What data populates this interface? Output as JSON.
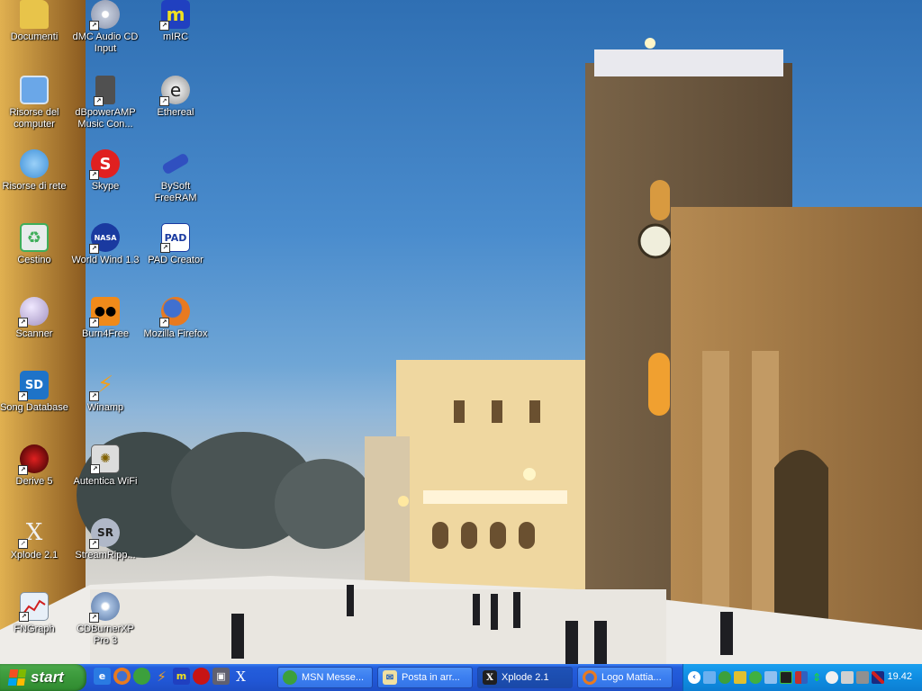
{
  "desktop_icons": [
    {
      "label": "Documenti",
      "icon": "folder-icon",
      "color": "#e8c44a"
    },
    {
      "label": "Risorse del computer",
      "icon": "computer-icon",
      "color": "#6aa7e8"
    },
    {
      "label": "Risorse di rete",
      "icon": "network-icon",
      "color": "#3d8fd8"
    },
    {
      "label": "Cestino",
      "icon": "recycle-bin-icon",
      "color": "#3fae5a"
    },
    {
      "label": "Scanner",
      "icon": "scanner-icon",
      "color": "#c8b8e0"
    },
    {
      "label": "Song Database",
      "icon": "song-database-icon",
      "color": "#1e73c8",
      "glyph": "SD"
    },
    {
      "label": "Derive 5",
      "icon": "derive-icon",
      "color": "#c81414"
    },
    {
      "label": "Xplode 2.1",
      "icon": "xplode-icon",
      "color": "#d8d8d8",
      "glyph": "X"
    },
    {
      "label": "FNGraph",
      "icon": "graph-icon",
      "color": "#e8f0f8"
    },
    {
      "label": "dMC Audio CD Input",
      "icon": "cd-icon",
      "color": "#c0c8d8"
    },
    {
      "label": "dBpowerAMP Music Con...",
      "icon": "speaker-icon",
      "color": "#606060"
    },
    {
      "label": "Skype",
      "icon": "skype-icon",
      "color": "#e02020",
      "glyph": "S"
    },
    {
      "label": "World Wind 1.3",
      "icon": "nasa-icon",
      "color": "#1a3aa0",
      "glyph": "NASA"
    },
    {
      "label": "Burn4Free",
      "icon": "burn4free-icon",
      "color": "#f08a1a"
    },
    {
      "label": "Winamp",
      "icon": "winamp-icon",
      "color": "#f0a020"
    },
    {
      "label": "Autentica WiFi",
      "icon": "wifi-icon",
      "color": "#dcdcdc"
    },
    {
      "label": "StreamRipp...",
      "icon": "streamripper-icon",
      "color": "#b0b8c8",
      "glyph": "SR"
    },
    {
      "label": "CDBurnerXP Pro 3",
      "icon": "cdburner-icon",
      "color": "#a8c0e0"
    },
    {
      "label": "mIRC",
      "icon": "mirc-icon",
      "color": "#2040c0",
      "glyph": "m"
    },
    {
      "label": "Ethereal",
      "icon": "ethereal-icon",
      "color": "#d0d0d0",
      "glyph": "e"
    },
    {
      "label": "BySoft FreeRAM",
      "icon": "freeram-icon",
      "color": "#3050c0"
    },
    {
      "label": "PAD Creator",
      "icon": "pad-icon",
      "color": "#1a3aa0",
      "glyph": "PAD"
    },
    {
      "label": "Mozilla Firefox",
      "icon": "firefox-icon",
      "color": "#e87a20"
    }
  ],
  "taskbar": {
    "start_label": "start",
    "quick_launch": [
      {
        "icon": "ie-icon",
        "color": "#2a7ae2"
      },
      {
        "icon": "firefox-icon",
        "color": "#e87a20"
      },
      {
        "icon": "messenger-icon",
        "color": "#3ca03c"
      },
      {
        "icon": "winamp-icon",
        "color": "#f0a020"
      },
      {
        "icon": "mirc-icon",
        "color": "#2040c0"
      },
      {
        "icon": "derive-icon",
        "color": "#c81414"
      },
      {
        "icon": "media-icon",
        "color": "#606070"
      },
      {
        "icon": "xplode-icon",
        "color": "#d8d8d8"
      }
    ],
    "windows": [
      {
        "label": "MSN Messe...",
        "icon": "messenger-icon",
        "color": "#3ca03c",
        "active": false
      },
      {
        "label": "Posta in arr...",
        "icon": "mail-icon",
        "color": "#f0e0a0",
        "active": false
      },
      {
        "label": "Xplode 2.1",
        "icon": "xplode-icon",
        "color": "#d8d8d8",
        "active": true
      },
      {
        "label": "Logo Mattia...",
        "icon": "firefox-icon",
        "color": "#e87a20",
        "active": false
      }
    ],
    "tray_icons": [
      {
        "icon": "expand-arrow-icon",
        "color": "#ffffff"
      },
      {
        "icon": "network-icon",
        "color": "#6ab0f0"
      },
      {
        "icon": "messenger-tray-icon",
        "color": "#3ca03c"
      },
      {
        "icon": "antivirus-icon",
        "color": "#e0c030"
      },
      {
        "icon": "shield-icon",
        "color": "#40b040"
      },
      {
        "icon": "network-connection-icon",
        "color": "#90c0f0"
      },
      {
        "icon": "chart-icon",
        "color": "#202020"
      },
      {
        "icon": "display-icon",
        "color": "#c03030"
      },
      {
        "icon": "updown-icon",
        "color": "#20c020"
      },
      {
        "icon": "chat-icon",
        "color": "#f0f0f0"
      },
      {
        "icon": "speaker-icon",
        "color": "#d0d0d0"
      },
      {
        "icon": "monitor-icon",
        "color": "#909090"
      },
      {
        "icon": "language-flag-icon",
        "color": "#d02020"
      }
    ],
    "clock": "19.42"
  }
}
